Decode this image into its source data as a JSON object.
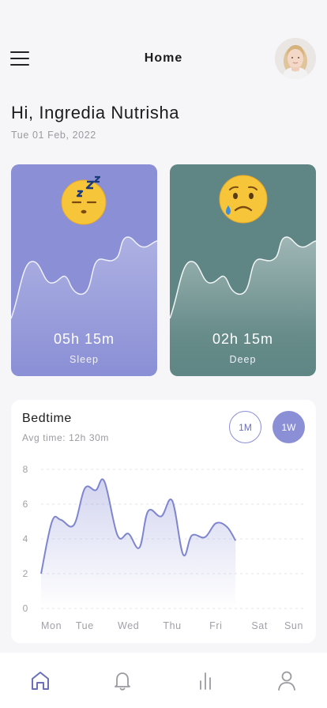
{
  "header": {
    "title": "Home",
    "menu_icon": "hamburger-menu-icon",
    "avatar_icon": "user-avatar"
  },
  "greeting": {
    "text": "Hi, Ingredia Nutrisha",
    "date": "Tue 01 Feb, 2022"
  },
  "cards": [
    {
      "value": "05h 15m",
      "label": "Sleep",
      "emoji": "sleeping-face-emoji",
      "color": "#8a8fd6"
    },
    {
      "value": "02h 15m",
      "label": "Deep",
      "emoji": "sad-tear-face-emoji",
      "color": "#5f8684"
    }
  ],
  "bedtime": {
    "title": "Bedtime",
    "subtitle": "Avg time: 12h 30m",
    "range_1m": "1M",
    "range_1w": "1W",
    "selected_range": "1W",
    "accent": "#8a8fd6"
  },
  "chart_data": {
    "type": "area",
    "title": "Bedtime",
    "categories": [
      "Mon",
      "Tue",
      "Wed",
      "Thu",
      "Fri",
      "Sat",
      "Sun"
    ],
    "x": [
      0,
      0.25,
      0.45,
      0.75,
      1.0,
      1.25,
      1.45,
      1.75,
      2.0,
      2.25,
      2.45,
      2.75,
      3.0,
      3.25,
      3.45,
      3.75,
      4.0,
      4.25,
      4.45,
      4.75,
      5.0,
      5.25,
      5.45,
      5.75,
      6.0
    ],
    "values": [
      2.0,
      4.9,
      5.1,
      4.8,
      6.9,
      6.8,
      7.3,
      4.2,
      4.3,
      3.6,
      5.6,
      5.3,
      6.2,
      3.1,
      4.2,
      4.1,
      4.9,
      4.8,
      3.9,
      null,
      null,
      null,
      null,
      null,
      null
    ],
    "y": [
      2.0,
      5.0,
      5.1,
      4.8,
      6.9,
      6.8,
      7.3,
      4.2,
      4.3,
      3.5,
      5.6,
      5.3,
      6.2,
      3.1,
      4.2,
      4.1,
      4.9,
      4.7,
      3.9
    ],
    "ylim": [
      0,
      8
    ],
    "yticks": [
      "0",
      "2",
      "4",
      "6",
      "8"
    ],
    "grid": true,
    "xlabel": "",
    "ylabel": ""
  },
  "nav": {
    "items": [
      {
        "name": "home",
        "icon": "home-icon",
        "active": true
      },
      {
        "name": "notifications",
        "icon": "bell-icon",
        "active": false
      },
      {
        "name": "statistics",
        "icon": "bar-chart-icon",
        "active": false
      },
      {
        "name": "profile",
        "icon": "user-icon",
        "active": false
      }
    ]
  }
}
